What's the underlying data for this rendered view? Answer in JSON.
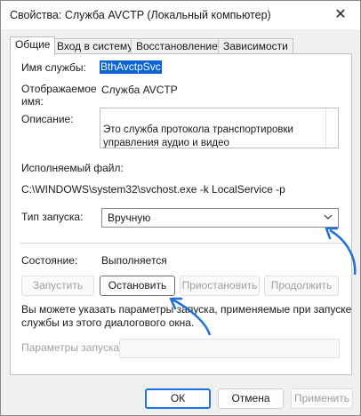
{
  "window": {
    "title": "Свойства: Служба AVCTP (Локальный компьютер)",
    "close_glyph": "✕"
  },
  "tabs": [
    {
      "label": "Общие"
    },
    {
      "label": "Вход в систему"
    },
    {
      "label": "Восстановление"
    },
    {
      "label": "Зависимости"
    }
  ],
  "general": {
    "service_name_label": "Имя службы:",
    "service_name_value": "BthAvctpSvc",
    "display_name_label_1": "Отображаемое",
    "display_name_label_2": "имя:",
    "display_name_value": "Служба AVCTP",
    "description_label": "Описание:",
    "description_value": "Это служба протокола транспортировки\nуправления аудио и видео",
    "exe_label": "Исполняемый файл:",
    "exe_path": "C:\\WINDOWS\\system32\\svchost.exe -k LocalService -p",
    "startup_type_label": "Тип запуска:",
    "startup_type_value": "Вручную",
    "status_label": "Состояние:",
    "status_value": "Выполняется",
    "buttons": {
      "start": "Запустить",
      "stop": "Остановить",
      "pause": "Приостановить",
      "resume": "Продолжить"
    },
    "hint_text_1": "Вы можете указать параметры запуска, применяемые при запуске",
    "hint_text_2": "службы из этого диалогового окна.",
    "start_params_label": "Параметры запуска:"
  },
  "footer": {
    "ok": "ОК",
    "cancel": "Отмена",
    "apply": "Применить"
  },
  "colors": {
    "accent": "#1a73e8",
    "selection": "#0a64d8"
  }
}
